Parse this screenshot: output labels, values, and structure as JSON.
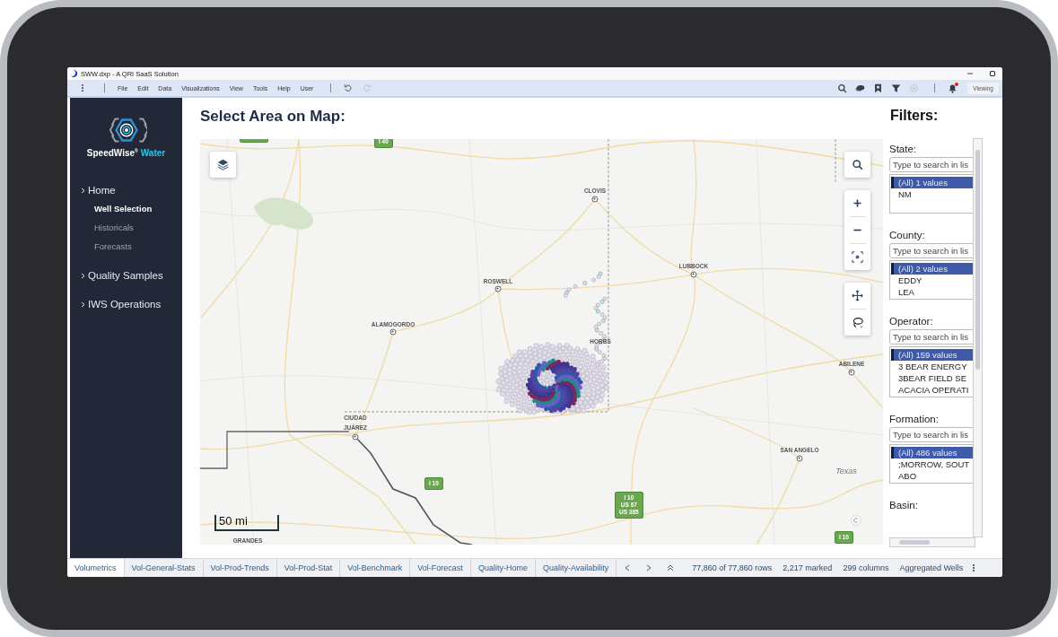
{
  "window": {
    "title": "SWW.dxp - A QRI SaaS Solution"
  },
  "menu_bar": {
    "items": [
      "File",
      "Edit",
      "Data",
      "Visualizations",
      "View",
      "Tools",
      "Help",
      "User"
    ],
    "history": [
      {
        "kind": "undo",
        "disabled": false
      },
      {
        "kind": "redo",
        "disabled": true
      }
    ],
    "tools": [
      {
        "kind": "search",
        "disabled": false,
        "alert": false
      },
      {
        "kind": "comments",
        "disabled": false,
        "alert": false
      },
      {
        "kind": "bookmark",
        "disabled": false,
        "alert": false
      },
      {
        "kind": "filter",
        "disabled": false,
        "alert": false
      },
      {
        "kind": "settings",
        "disabled": true,
        "alert": false
      },
      {
        "kind": "notifications",
        "disabled": false,
        "alert": true
      }
    ],
    "mode_button": "Viewing"
  },
  "sidebar": {
    "brand": "SpeedWise$^{®}$",
    "brand_accent": "Water",
    "nav": [
      {
        "label": "Home",
        "children": [
          {
            "label": "Well Selection",
            "selected": true
          },
          {
            "label": "Historicals",
            "selected": false
          },
          {
            "label": "Forecasts",
            "selected": false
          }
        ]
      },
      {
        "label": "Quality Samples"
      },
      {
        "label": "IWS Operations"
      }
    ]
  },
  "main": {
    "title": "Select Area on Map:"
  },
  "map": {
    "places": [
      {
        "label": "CLOVIS",
        "kind": "city"
      },
      {
        "label": "ROSWELL",
        "kind": "city"
      },
      {
        "label": "LUBBOCK",
        "kind": "city"
      },
      {
        "label": "ALAMOGORDO",
        "kind": "city"
      },
      {
        "label": "HOBBS",
        "kind": "town"
      },
      {
        "label": "ABILENE",
        "kind": "city"
      },
      {
        "label": "CIUDAD JUÁREZ",
        "kind": "city"
      },
      {
        "label": "SAN ANGELO",
        "kind": "city"
      },
      {
        "label": "Texas",
        "kind": "region"
      },
      {
        "label": "GRANDES",
        "kind": "town"
      }
    ],
    "shields": [
      {
        "lines": [
          "I 40"
        ]
      },
      {
        "lines": [
          "I 10"
        ]
      },
      {
        "lines": [
          "I 10",
          "US 67",
          "US 385"
        ]
      },
      {
        "lines": [
          "I 10"
        ]
      }
    ],
    "scale": "50 mi"
  },
  "filters": {
    "title": "Filters:",
    "groups": [
      {
        "label": "State:",
        "placeholder": "Type to search in lis",
        "items": [
          {
            "text": "(All) 1 values",
            "selected": true
          },
          {
            "text": "NM",
            "selected": false
          }
        ]
      },
      {
        "label": "County:",
        "placeholder": "Type to search in lis",
        "items": [
          {
            "text": "(All) 2 values",
            "selected": true
          },
          {
            "text": "EDDY",
            "selected": false
          },
          {
            "text": "LEA",
            "selected": false
          }
        ]
      },
      {
        "label": "Operator:",
        "placeholder": "Type to search in lis",
        "items": [
          {
            "text": "(All) 159 values",
            "selected": true
          },
          {
            "text": "3 BEAR ENERGY",
            "selected": false
          },
          {
            "text": "3BEAR FIELD SE",
            "selected": false
          },
          {
            "text": "ACACIA OPERATI",
            "selected": false
          }
        ]
      },
      {
        "label": "Formation:",
        "placeholder": "Type to search in lis",
        "items": [
          {
            "text": "(All) 486 values",
            "selected": true
          },
          {
            "text": ";MORROW, SOUT",
            "selected": false
          },
          {
            "text": "ABO",
            "selected": false
          }
        ]
      },
      {
        "label": "Basin:"
      }
    ]
  },
  "tabs": [
    {
      "label": "Volumetrics",
      "selected": true
    },
    {
      "label": "Vol-General-Stats",
      "selected": false
    },
    {
      "label": "Vol-Prod-Trends",
      "selected": false
    },
    {
      "label": "Vol-Prod-Stat",
      "selected": false
    },
    {
      "label": "Vol-Benchmark",
      "selected": false
    },
    {
      "label": "Vol-Forecast",
      "selected": false
    },
    {
      "label": "Quality-Home",
      "selected": false
    },
    {
      "label": "Quality-Availability",
      "selected": false
    }
  ],
  "status_bar": {
    "rows": "77,860 of 77,860 rows",
    "marked": "2,217 marked",
    "columns": "299 columns",
    "view": "Aggregated Wells"
  }
}
